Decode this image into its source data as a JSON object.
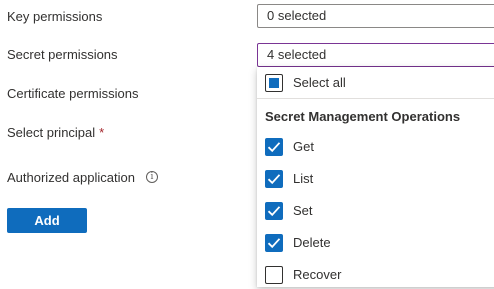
{
  "form": {
    "key_permissions_label": "Key permissions",
    "key_permissions_value": "0 selected",
    "secret_permissions_label": "Secret permissions",
    "secret_permissions_value": "4 selected",
    "certificate_permissions_label": "Certificate permissions",
    "select_principal_label": "Select principal",
    "required_marker": "*",
    "authorized_application_label": "Authorized application",
    "info_icon_glyph": "i",
    "add_button_label": "Add"
  },
  "dropdown": {
    "select_all_label": "Select all",
    "select_all_state": "partial",
    "group_heading": "Secret Management Operations",
    "items": [
      {
        "label": "Get",
        "checked": true
      },
      {
        "label": "List",
        "checked": true
      },
      {
        "label": "Set",
        "checked": true
      },
      {
        "label": "Delete",
        "checked": true
      },
      {
        "label": "Recover",
        "checked": false
      }
    ]
  },
  "colors": {
    "accent": "#0f6cbd",
    "active_border": "#7a3595",
    "required": "#a4262c"
  }
}
